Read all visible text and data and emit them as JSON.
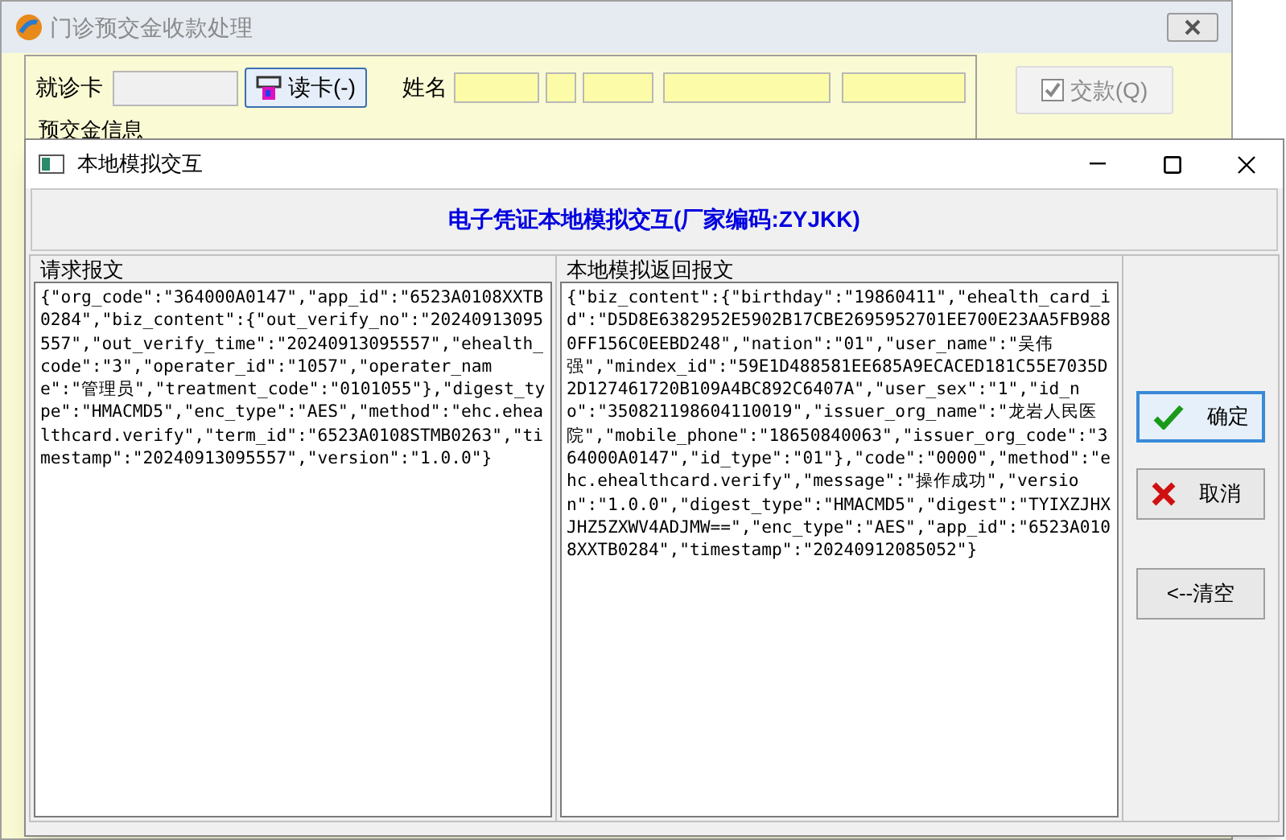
{
  "main_window": {
    "title": "门诊预交金收款处理",
    "card_label": "就诊卡",
    "read_card_button": "读卡(-)",
    "name_label": "姓名",
    "pay_button": {
      "label": "交款(Q)",
      "disabled": true
    },
    "group_title": "预交金信息"
  },
  "dialog": {
    "title": "本地模拟交互",
    "heading": "电子凭证本地模拟交互(厂家编码:ZYJKK)",
    "panels": [
      {
        "title": "请求报文",
        "text": "{\"org_code\":\"364000A0147\",\"app_id\":\"6523A0108XXTB0284\",\"biz_content\":{\"out_verify_no\":\"20240913095557\",\"out_verify_time\":\"20240913095557\",\"ehealth_code\":\"3\",\"operater_id\":\"1057\",\"operater_name\":\"管理员\",\"treatment_code\":\"0101055\"},\"digest_type\":\"HMACMD5\",\"enc_type\":\"AES\",\"method\":\"ehc.ehealthcard.verify\",\"term_id\":\"6523A0108STMB0263\",\"timestamp\":\"20240913095557\",\"version\":\"1.0.0\"}"
      },
      {
        "title": "本地模拟返回报文",
        "text": "{\"biz_content\":{\"birthday\":\"19860411\",\"ehealth_card_id\":\"D5D8E6382952E5902B17CBE2695952701EE700E23AA5FB9880FF156C0EEBD248\",\"nation\":\"01\",\"user_name\":\"吴伟强\",\"mindex_id\":\"59E1D488581EE685A9ECACED181C55E7035D2D127461720B109A4BC892C6407A\",\"user_sex\":\"1\",\"id_no\":\"350821198604110019\",\"issuer_org_name\":\"龙岩人民医院\",\"mobile_phone\":\"18650840063\",\"issuer_org_code\":\"364000A0147\",\"id_type\":\"01\"},\"code\":\"0000\",\"method\":\"ehc.ehealthcard.verify\",\"message\":\"操作成功\",\"version\":\"1.0.0\",\"digest_type\":\"HMACMD5\",\"digest\":\"TYIXZJHXJHZ5ZXWV4ADJMW==\",\"enc_type\":\"AES\",\"app_id\":\"6523A0108XXTB0284\",\"timestamp\":\"20240912085052\"}"
      }
    ],
    "buttons": [
      {
        "kind": "confirm",
        "label": "确定",
        "selected": true
      },
      {
        "kind": "cancel",
        "label": "取消",
        "selected": false
      },
      {
        "kind": "clear",
        "label": "<--清空",
        "selected": false
      }
    ]
  }
}
